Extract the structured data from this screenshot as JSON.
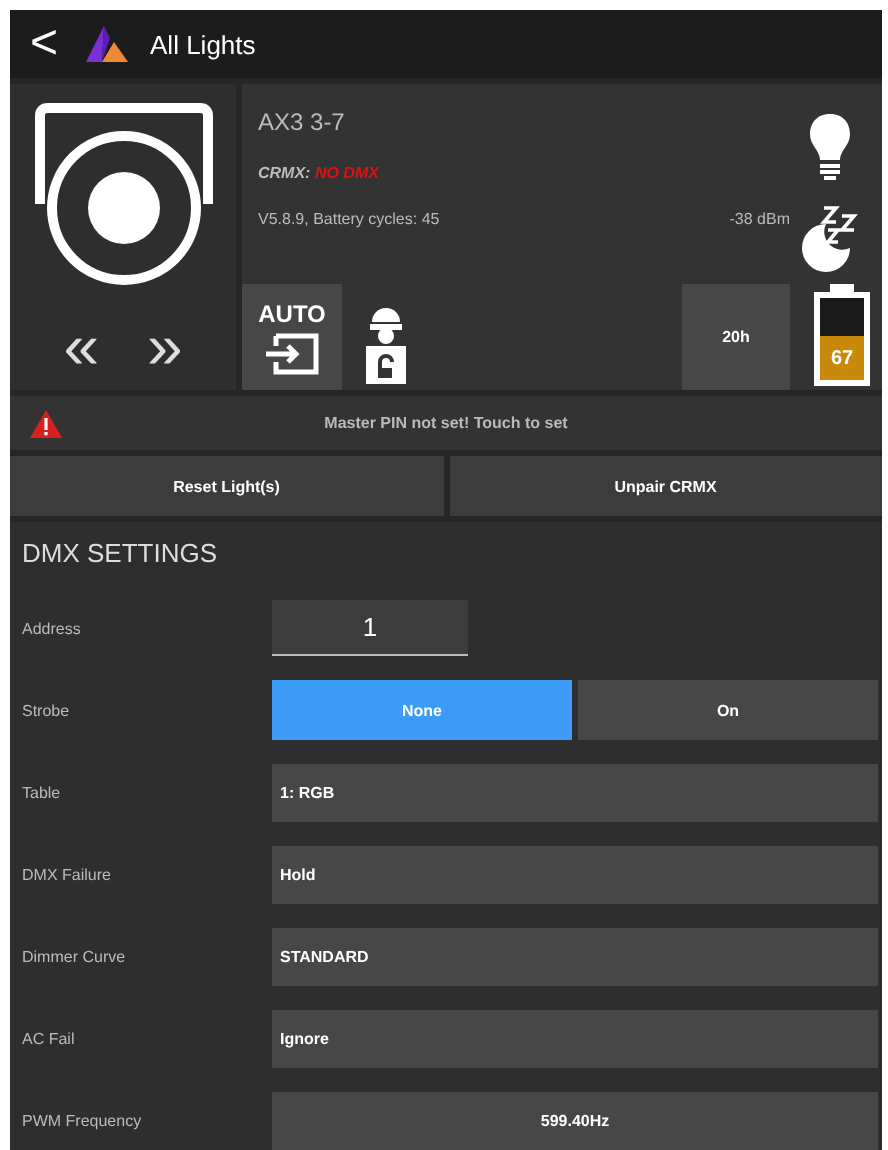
{
  "header": {
    "back": "<",
    "title": "All Lights"
  },
  "device": {
    "name": "AX3 3-7",
    "link_label": "CRMX:",
    "link_status": "NO DMX",
    "firmware": "V5.8.9, Battery cycles: 45",
    "signal": "-38 dBm",
    "mode": "AUTO",
    "runtime": "20h",
    "battery": {
      "level": 0.55,
      "text": "67"
    },
    "prev": "«",
    "next": "»"
  },
  "warning": {
    "text": "Master PIN not set! Touch to set"
  },
  "actions": [
    "Reset Light(s)",
    "Unpair CRMX"
  ],
  "section_title": "DMX SETTINGS",
  "settings": [
    {
      "label": "Address",
      "kind": "number",
      "value": "1"
    },
    {
      "label": "Strobe",
      "kind": "toggle",
      "options": [
        {
          "label": "None",
          "selected": true
        },
        {
          "label": "On",
          "selected": false
        }
      ]
    },
    {
      "label": "Table",
      "kind": "select",
      "value": "1: RGB"
    },
    {
      "label": "DMX Failure",
      "kind": "select",
      "value": "Hold"
    },
    {
      "label": "Dimmer Curve",
      "kind": "select",
      "value": "STANDARD"
    },
    {
      "label": "AC Fail",
      "kind": "select",
      "value": "Ignore"
    },
    {
      "label": "PWM Frequency",
      "kind": "centered",
      "value": "599.40Hz"
    }
  ]
}
